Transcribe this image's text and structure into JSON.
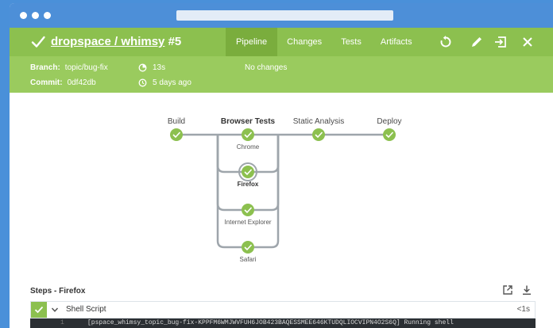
{
  "header": {
    "repo": "dropspace / whimsy",
    "run": "#5",
    "tabs": [
      "Pipeline",
      "Changes",
      "Tests",
      "Artifacts"
    ],
    "active_tab": "Pipeline",
    "status_color": "#8cc04f"
  },
  "summary": {
    "branch_label": "Branch:",
    "branch_value": "topic/bug-fix",
    "commit_label": "Commit:",
    "commit_value": "0df42db",
    "duration": "13s",
    "time_ago": "5 days ago",
    "changes": "No changes"
  },
  "pipeline": {
    "stages": [
      "Build",
      "Browser Tests",
      "Static Analysis",
      "Deploy"
    ],
    "parallel_branches": [
      "Chrome",
      "Firefox",
      "Internet Explorer",
      "Safari"
    ],
    "selected_branch": "Firefox"
  },
  "steps": {
    "title": "Steps - Firefox",
    "items": [
      {
        "name": "Shell Script",
        "duration": "<1s",
        "status": "success"
      }
    ]
  },
  "log": {
    "line_number": "1",
    "text": "[pspace_whimsy_topic_bug-fix-KPPFM6WMJWVFUH6JOB423BAQESSMEE646KTUDQLIOCVIPN4O2S6Q] Running shell"
  }
}
